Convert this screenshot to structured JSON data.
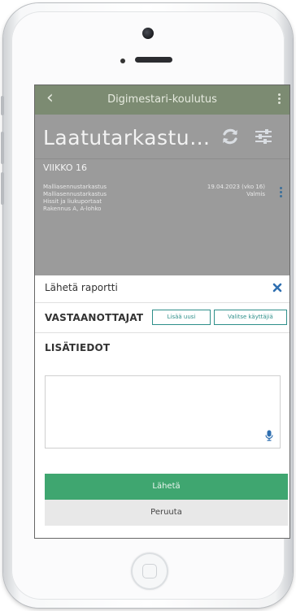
{
  "app_bar": {
    "title": "Digimestari-koulutus"
  },
  "header": {
    "title": "Laatutarkastu…"
  },
  "week": {
    "label": "VIIKKO 16"
  },
  "inspection_item": {
    "line1": "Malliasennustarkastus",
    "line2": "Malliasennustarkastus",
    "line3": "Hissit ja liukuportaat",
    "line4": "Rakennus A, A-lohko",
    "date": "19.04.2023 (vko 16)",
    "status": "Valmis"
  },
  "dialog": {
    "title": "Lähetä raportti",
    "recipients_label": "VASTAANOTTAJAT",
    "add_new_label": "Lisää uusi",
    "select_users_label": "Valitse käyttäjiä",
    "details_label": "LISÄTIEDOT",
    "details_value": "",
    "send_label": "Lähetä",
    "cancel_label": "Peruuta"
  },
  "colors": {
    "app_bar": "#7c8b72",
    "overlay_gray": "#9b9b9b",
    "accent_teal": "#2e8f8a",
    "send_green": "#3fa670",
    "icon_blue": "#2f6fb0"
  },
  "icons": [
    "back-arrow-icon",
    "more-vert-icon",
    "refresh-icon",
    "filter-sliders-icon",
    "close-icon",
    "microphone-icon"
  ]
}
